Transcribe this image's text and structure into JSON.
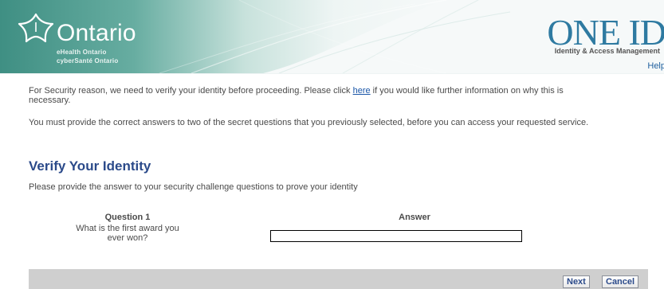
{
  "header": {
    "brand_name": "Ontario",
    "brand_line1": "eHealth Ontario",
    "brand_line2": "cyberSanté Ontario",
    "product_name": "ONE ID",
    "product_tagline": "Identity & Access Management",
    "help_label": "Help"
  },
  "intro": {
    "text_before": "For Security reason, we need to verify your identity before proceeding. Please click ",
    "link": "here",
    "text_after": " if you would like further information on why this is necessary.",
    "paragraph2": "You must provide the correct answers to two of the secret questions that you previously selected, before you can access your requested service."
  },
  "section": {
    "title": "Verify Your Identity",
    "subtitle": "Please provide the answer to your security challenge questions to prove your identity"
  },
  "question": {
    "header": "Question 1",
    "text": "What is the first award you ever won?",
    "answer_header": "Answer",
    "answer_value": ""
  },
  "actions": {
    "next": "Next",
    "cancel": "Cancel"
  },
  "colors": {
    "title": "#2b4a8a",
    "banner_green": "#4a9a8c",
    "oneid_blue": "#2e7aa1",
    "footer_bar": "#cfcfcf"
  }
}
